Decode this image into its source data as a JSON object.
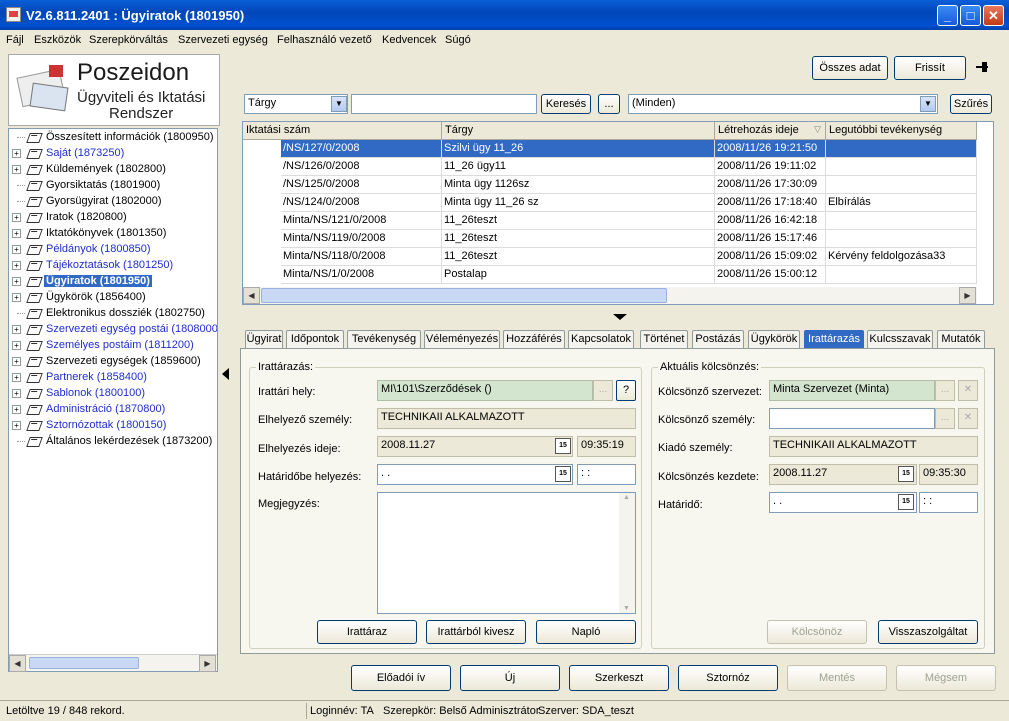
{
  "window": {
    "title": "V2.6.811.2401 : Ügyiratok (1801950)"
  },
  "menu": [
    "Fájl",
    "Eszközök",
    "Szerepkörváltás",
    "Szervezeti egység",
    "Felhasználó vezető",
    "Kedvencek",
    "Súgó"
  ],
  "logo": {
    "line1": "Poszeidon",
    "line2": "Ügyviteli és Iktatási",
    "line3": "Rendszer"
  },
  "tree": [
    {
      "label": "Összesített információk (1800950)",
      "expandable": false,
      "blue": false,
      "selected": false
    },
    {
      "label": "Saját (1873250)",
      "expandable": true,
      "blue": true,
      "selected": false
    },
    {
      "label": "Küldemények (1802800)",
      "expandable": true,
      "blue": false,
      "selected": false
    },
    {
      "label": "Gyorsiktatás (1801900)",
      "expandable": false,
      "blue": false,
      "selected": false
    },
    {
      "label": "Gyorsügyirat (1802000)",
      "expandable": false,
      "blue": false,
      "selected": false
    },
    {
      "label": "Iratok (1820800)",
      "expandable": true,
      "blue": false,
      "selected": false
    },
    {
      "label": "Iktatókönyvek (1801350)",
      "expandable": true,
      "blue": false,
      "selected": false
    },
    {
      "label": "Példányok (1800850)",
      "expandable": true,
      "blue": true,
      "selected": false
    },
    {
      "label": "Tájékoztatások (1801250)",
      "expandable": true,
      "blue": true,
      "selected": false
    },
    {
      "label": "Ügyiratok (1801950)",
      "expandable": true,
      "blue": false,
      "selected": true
    },
    {
      "label": "Ügykörök (1856400)",
      "expandable": true,
      "blue": false,
      "selected": false
    },
    {
      "label": "Elektronikus dossziék (1802750)",
      "expandable": false,
      "blue": false,
      "selected": false
    },
    {
      "label": "Szervezeti egység postái (1808000)",
      "expandable": true,
      "blue": true,
      "selected": false
    },
    {
      "label": "Személyes postáim (1811200)",
      "expandable": true,
      "blue": true,
      "selected": false
    },
    {
      "label": "Szervezeti egységek (1859600)",
      "expandable": true,
      "blue": false,
      "selected": false
    },
    {
      "label": "Partnerek (1858400)",
      "expandable": true,
      "blue": true,
      "selected": false
    },
    {
      "label": "Sablonok (1800100)",
      "expandable": true,
      "blue": true,
      "selected": false
    },
    {
      "label": "Administráció (1870800)",
      "expandable": true,
      "blue": true,
      "selected": false
    },
    {
      "label": "Sztornózottak (1800150)",
      "expandable": true,
      "blue": true,
      "selected": false
    },
    {
      "label": "Általános lekérdezések (1873200)",
      "expandable": false,
      "blue": false,
      "selected": false
    }
  ],
  "toolbar": {
    "all_data_label": "Összes adat",
    "refresh_label": "Frissít",
    "pin_icon": "pin-icon"
  },
  "search": {
    "field_select": "Tárgy",
    "text_value": "",
    "search_label": "Keresés",
    "ellipsis_label": "...",
    "filter_select": "(Minden)",
    "filter_label": "Szűrés"
  },
  "grid": {
    "columns": [
      "Iktatási szám",
      "Tárgy",
      "Létrehozás ideje",
      "Legutóbbi tevékenység"
    ],
    "rows": [
      [
        "/NS/127/0/2008",
        "Szilvi ügy 11_26",
        "2008/11/26 19:21:50",
        ""
      ],
      [
        "/NS/126/0/2008",
        "11_26 ügy11",
        "2008/11/26 19:11:02",
        ""
      ],
      [
        "/NS/125/0/2008",
        "Minta ügy 1126sz",
        "2008/11/26 17:30:09",
        ""
      ],
      [
        "/NS/124/0/2008",
        "Minta ügy 11_26 sz",
        "2008/11/26 17:18:40",
        "Elbírálás"
      ],
      [
        "Minta/NS/121/0/2008",
        "11_26teszt",
        "2008/11/26 16:42:18",
        ""
      ],
      [
        "Minta/NS/119/0/2008",
        "11_26teszt",
        "2008/11/26 15:17:46",
        ""
      ],
      [
        "Minta/NS/118/0/2008",
        "11_26teszt",
        "2008/11/26 15:09:02",
        "Kérvény feldolgozása33"
      ],
      [
        "Minta/NS/1/0/2008",
        "Postalap",
        "2008/11/26 15:00:12",
        ""
      ]
    ],
    "selected_row": 0
  },
  "tabs": [
    "Ügyirat",
    "Időpontok",
    "Tevékenység",
    "Véleményezés",
    "Hozzáférés",
    "Kapcsolatok",
    "Történet",
    "Postázás",
    "Ügykörök",
    "Irattárazás",
    "Kulcsszavak",
    "Mutatók"
  ],
  "active_tab": "Irattárazás",
  "archive": {
    "title": "Irattárazás:",
    "location_label": "Irattári hely:",
    "location_value": "MI\\101\\Szerződések ()",
    "holder_label": "Elhelyező személy:",
    "holder_value": "TECHNIKAII ALKALMAZOTT",
    "time_label": "Elhelyezés ideje:",
    "time_date": "2008.11.27",
    "time_clock": "09:35:19",
    "deadline_label": "Határidőbe helyezés:",
    "deadline_date": "  .  .",
    "deadline_clock": " :  :",
    "note_label": "Megjegyzés:",
    "note_value": "",
    "btn_archive": "Irattáraz",
    "btn_remove": "Irattárból kivesz",
    "btn_log": "Napló",
    "help_label": "?",
    "ellipsis_label": "..."
  },
  "loan": {
    "title": "Aktuális kölcsönzés:",
    "org_label": "Kölcsönző szervezet:",
    "org_value": "Minta Szervezet (Minta)",
    "person_label": "Kölcsönző személy:",
    "person_value": "",
    "issuer_label": "Kiadó személy:",
    "issuer_value": "TECHNIKAII ALKALMAZOTT",
    "start_label": "Kölcsönzés kezdete:",
    "start_date": "2008.11.27",
    "start_clock": "09:35:30",
    "due_label": "Határidő:",
    "due_date": "  .  .",
    "due_clock": " :  :",
    "btn_lend": "Kölcsönöz",
    "btn_return": "Visszaszolgáltat",
    "ellipsis_label": "...",
    "clear_label": "✕"
  },
  "bottom_buttons": {
    "report": "Előadói ív",
    "new": "Új",
    "edit": "Szerkeszt",
    "cancel_record": "Sztornóz",
    "save": "Mentés",
    "discard": "Mégsem"
  },
  "status": {
    "records": "Letöltve 19 / 848 rekord.",
    "login": "Loginnév: TA",
    "role": "Szerepkör: Belső Adminisztrátor",
    "server": "Szerver: SDA_teszt"
  },
  "cal_icon_text": "15"
}
